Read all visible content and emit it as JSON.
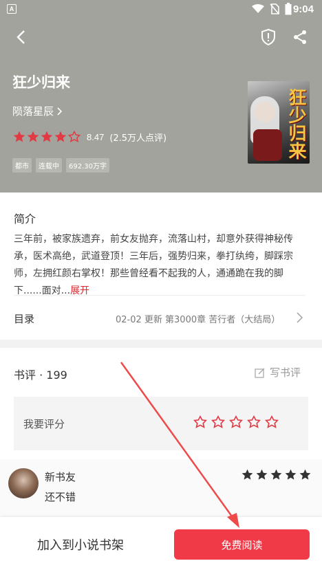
{
  "status_bar": {
    "time": "9:04",
    "app_badge": "A"
  },
  "book": {
    "title": "狂少归来",
    "author": "陨落星辰",
    "score": "8.47",
    "rating_count": "(2.5万人点评)",
    "rating_stars": 4.5,
    "tags": [
      "都市",
      "连载中",
      "692.30万字"
    ],
    "cover_title": "狂少归来"
  },
  "intro": {
    "heading": "简介",
    "text": "三年前，被家族遗弃，前女友抛弃，流落山村，却意外获得神秘传承，医术高绝，武道登顶！三年后，强势归来，拳打纨绔，脚踩宗师，左拥红颜右掌权！那些曾经看不起我的人，通通跪在我的脚下......面对...",
    "expand_label": "展开"
  },
  "toc": {
    "label": "目录",
    "update": "02-02  更新  第3000章 苦行者（大结局）"
  },
  "reviews": {
    "title": "书评 · 199",
    "write_label": "写书评",
    "rate_label": "我要评分",
    "comment": {
      "user": "新书友",
      "text": "还不错",
      "stars": 5
    }
  },
  "bottom": {
    "add_shelf": "加入到小说书架",
    "read_free": "免费阅读"
  },
  "colors": {
    "header_bg": "#a3a39d",
    "accent": "#f03a47",
    "star_red": "#e23a45"
  }
}
